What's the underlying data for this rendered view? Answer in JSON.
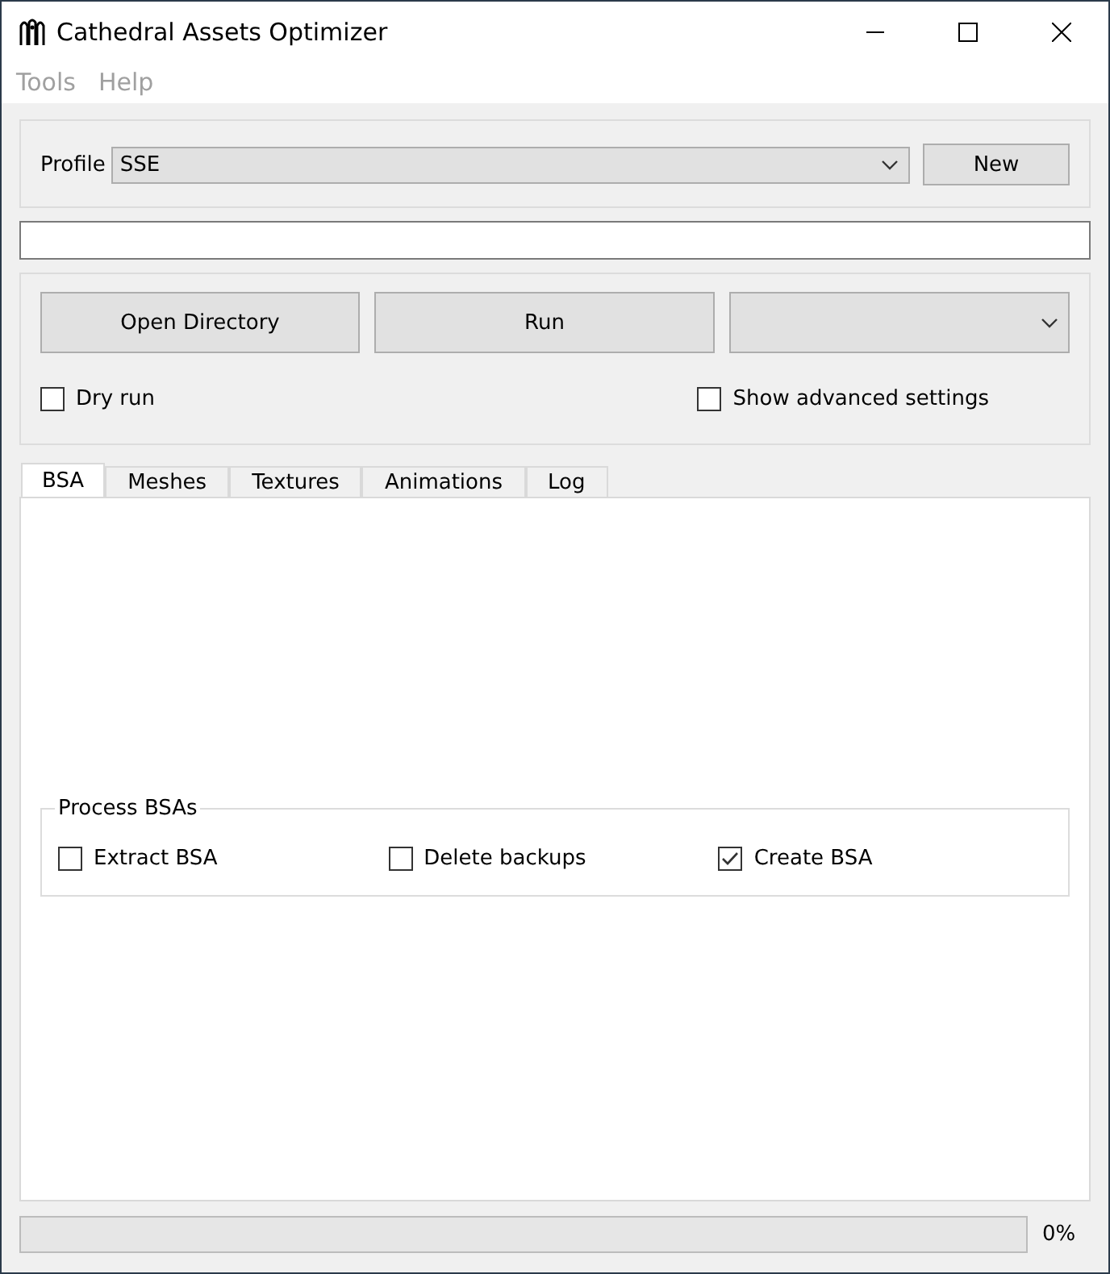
{
  "window": {
    "title": "Cathedral Assets Optimizer"
  },
  "menu": [
    {
      "label": "Tools",
      "disabled": true
    },
    {
      "label": "Help",
      "disabled": true
    }
  ],
  "profile": {
    "label": "Profile",
    "value": "SSE",
    "new_button": "New"
  },
  "actions": {
    "open_button": "Open Directory",
    "run_button": "Run",
    "dry_run": {
      "label": "Dry run",
      "checked": false
    },
    "advanced": {
      "label": "Show advanced settings",
      "checked": false
    }
  },
  "tabs": [
    {
      "label": "BSA",
      "selected": true
    },
    {
      "label": "Meshes",
      "selected": false
    },
    {
      "label": "Textures",
      "selected": false
    },
    {
      "label": "Animations",
      "selected": false
    },
    {
      "label": "Log",
      "selected": false
    }
  ],
  "process_bsas": {
    "title": "Process BSAs",
    "options": [
      {
        "label": "Extract BSA",
        "checked": false
      },
      {
        "label": "Delete backups",
        "checked": false
      },
      {
        "label": "Create BSA",
        "checked": true
      }
    ]
  },
  "progress": {
    "level": 0,
    "reading": "0%"
  }
}
